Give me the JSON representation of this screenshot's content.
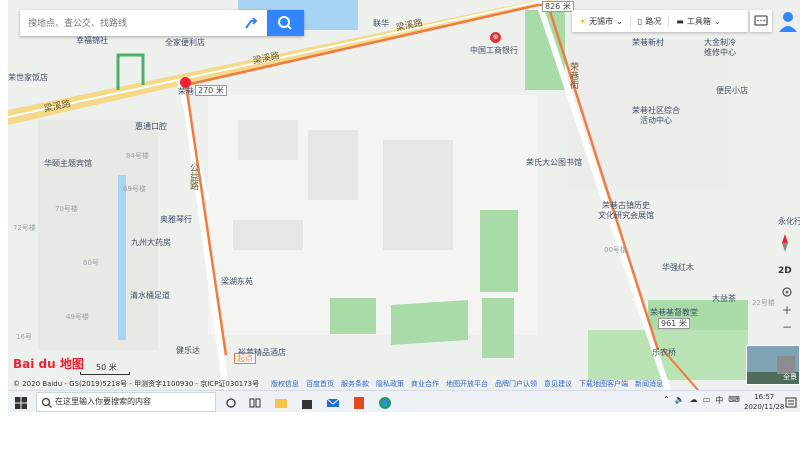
{
  "search": {
    "placeholder": "搜地点、查公交、找路线"
  },
  "toolbar": {
    "weather_label": "无锡市",
    "traffic_label": "路况",
    "toolbox_label": "工具箱"
  },
  "map": {
    "roads": {
      "liangxi_top": "梁溪路",
      "liangxi_mid": "梁溪路",
      "liangxi_left": "梁溪路",
      "gongyi": "公益路",
      "rongxiang": "荣巷街"
    },
    "pois": {
      "xingfu": "幸福锦社",
      "quanjia": "全家便利店",
      "lianhua": "联华",
      "icbc": "中国工商银行",
      "rongshi_jiayin": "荣世家饭店",
      "rongxiang_cun": "荣巷新村",
      "daye": "大金制冷",
      "daye2": "维修中心",
      "rongxiang_community": "荣巷社区综合",
      "rongxiang_community2": "活动中心",
      "bianmin": "便民小店",
      "huitongkou": "惠通口腔",
      "huayuan": "华颐主题宾馆",
      "qiaozhu": "奥雅琴行",
      "jiuzhou": "九州大药房",
      "qingshui": "清水桶足道",
      "liangxi_dongyuan": "梁湖东苑",
      "rongshi_library": "荣氏大公图书馆",
      "rongxiang_ancient": "荣巷古镇历史",
      "rongxiang_ancient2": "文化研究会展馆",
      "huaqiang": "华强红木",
      "dayi": "大益茶",
      "jidujiao": "荣巷基督教堂",
      "lenong": "乐农桥",
      "jianlejian": "健乐达",
      "yuhang": "裕莱精品酒店",
      "yonghua": "永化行",
      "rongxiang_entry": "荣巷"
    },
    "buildings": [
      "84号楼",
      "69号楼",
      "70号楼",
      "72号楼",
      "60号",
      "49号楼",
      "00号楼",
      "22号楼",
      "16号"
    ],
    "distances": {
      "d1": "270 米",
      "d2": "826 米",
      "d3": "961 米"
    },
    "start_marker": "起点",
    "mode_2d": "2D",
    "panorama_label": "全景",
    "scale_label": "50 米",
    "logo_text": "Bai du 地图"
  },
  "footer": {
    "copyright": "© 2020 Baidu - GS(2019)5218号 - 甲测资字1100930 - 京ICP证030173号",
    "links": [
      "版权信息",
      "百度首页",
      "服务条款",
      "隐私政策",
      "商业合作",
      "地图开放平台",
      "品牌门户认领",
      "意见建议",
      "下载地图客户端",
      "新闻消息"
    ]
  },
  "taskbar": {
    "search_placeholder": "在这里输入你要搜索的内容",
    "tray_ime": "中",
    "time": "16:57",
    "date": "2020/11/28"
  },
  "colors": {
    "accent": "#3385ff",
    "route": "#f07b3f",
    "road_major": "#f5d98a",
    "green": "#a8dba8",
    "water": "#a7d4f2"
  }
}
